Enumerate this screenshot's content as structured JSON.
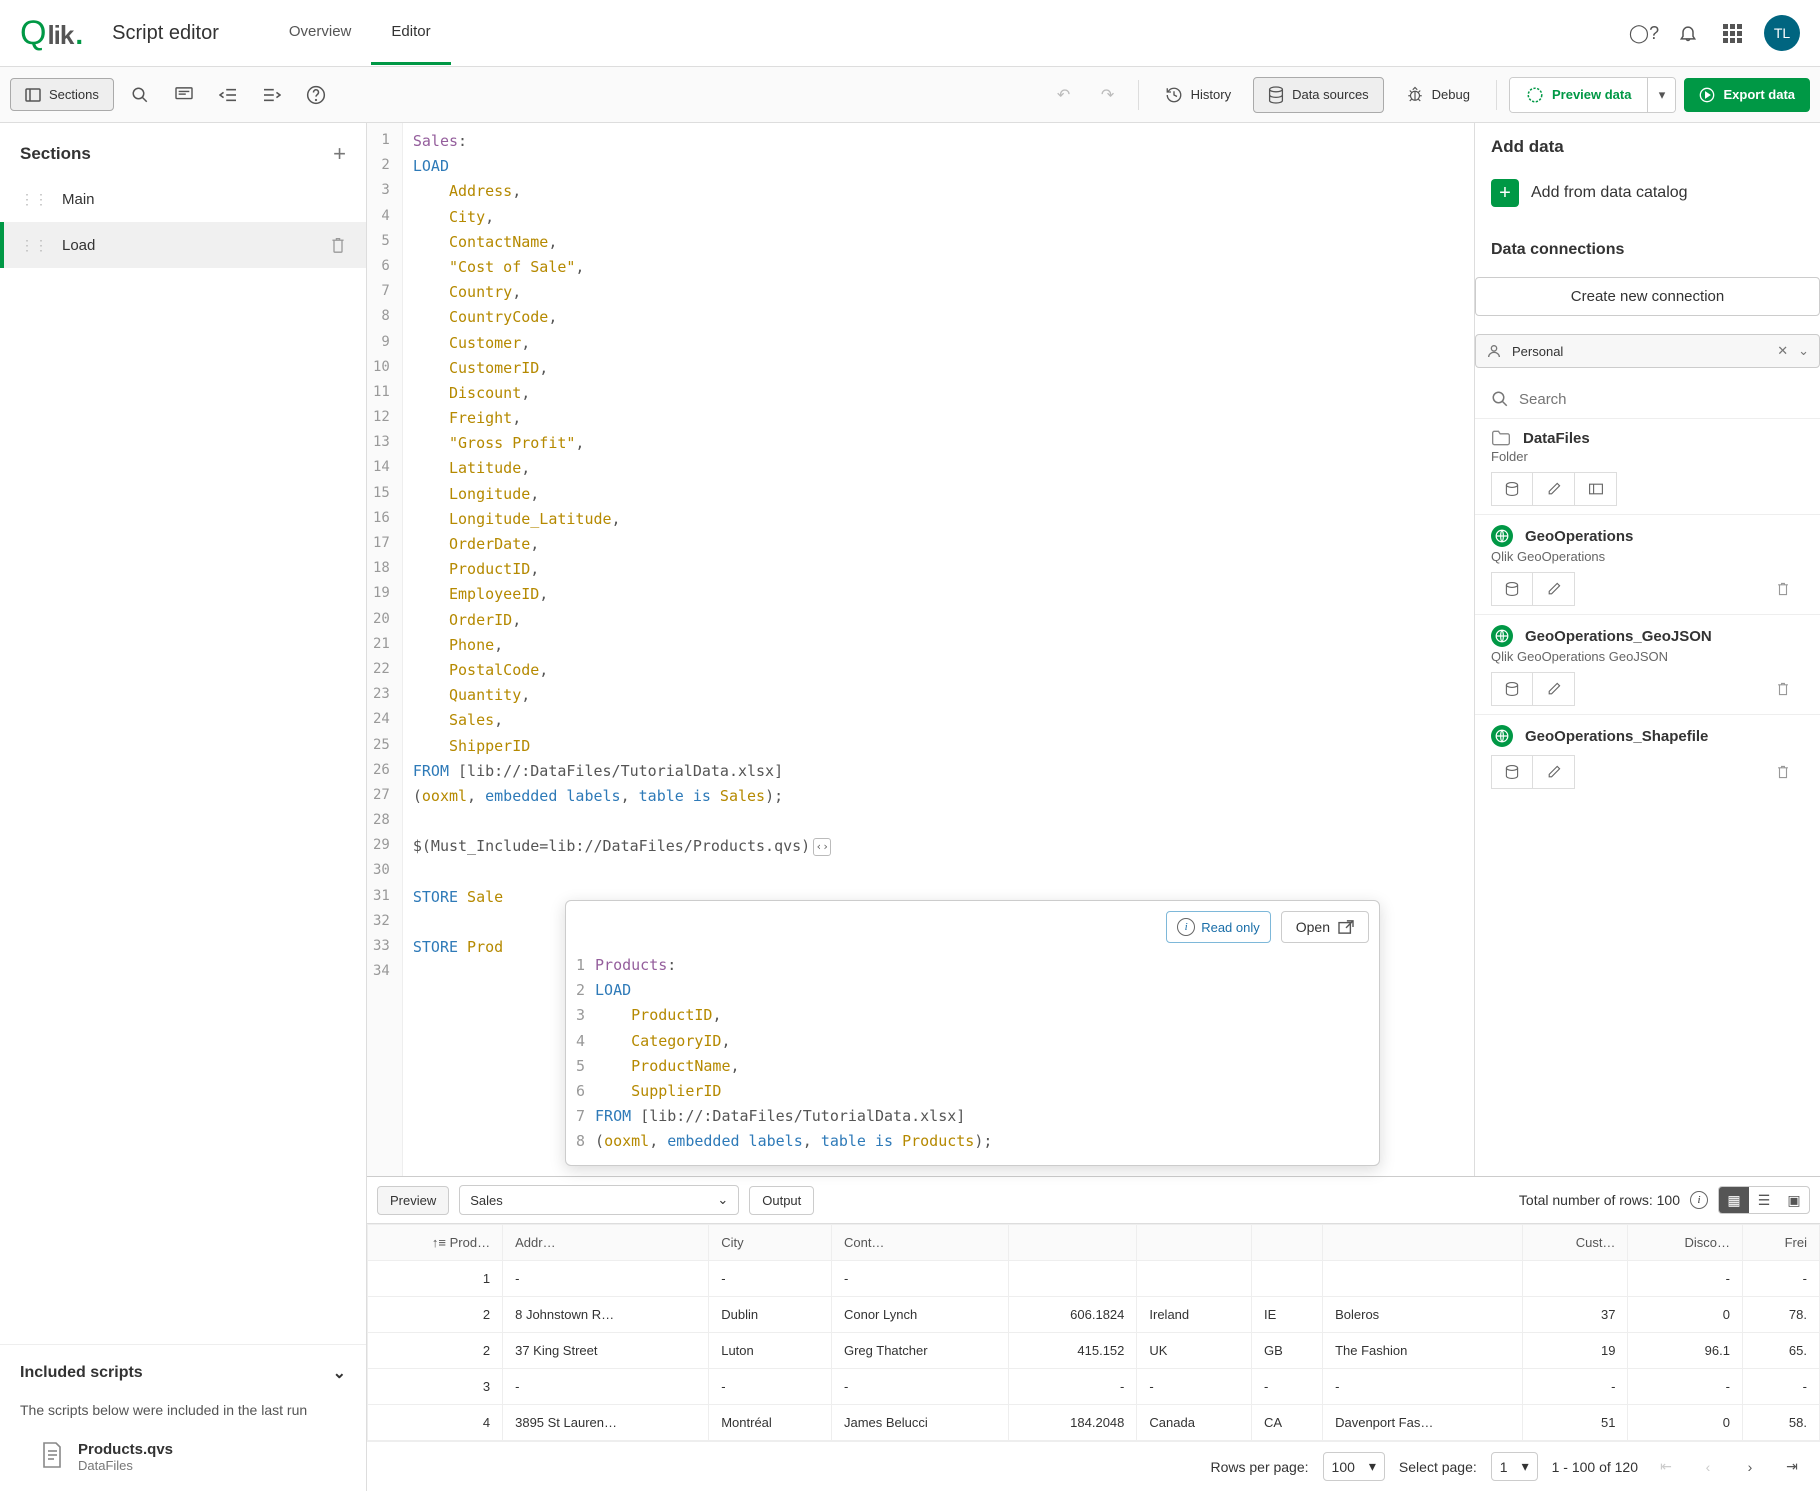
{
  "header": {
    "logo": "Qlik",
    "app_title": "Script editor",
    "tabs": {
      "overview": "Overview",
      "editor": "Editor"
    },
    "avatar": "TL"
  },
  "toolbar": {
    "sections": "Sections",
    "history": "History",
    "data_sources": "Data sources",
    "debug": "Debug",
    "preview_data": "Preview data",
    "export_data": "Export data"
  },
  "sidebar": {
    "title": "Sections",
    "items": [
      {
        "label": "Main",
        "selected": false
      },
      {
        "label": "Load",
        "selected": true
      }
    ],
    "included_title": "Included scripts",
    "included_note": "The scripts below were included in the last run",
    "included_file": {
      "name": "Products.qvs",
      "sub": "DataFiles"
    }
  },
  "editor": {
    "lines": [
      {
        "n": 1,
        "tokens": [
          [
            "label",
            "Sales"
          ],
          [
            "punc",
            ":"
          ]
        ]
      },
      {
        "n": 2,
        "tokens": [
          [
            "kw",
            "LOAD"
          ]
        ]
      },
      {
        "n": 3,
        "tokens": [
          [
            "pad",
            "    "
          ],
          [
            "field",
            "Address"
          ],
          [
            "punc",
            ","
          ]
        ]
      },
      {
        "n": 4,
        "tokens": [
          [
            "pad",
            "    "
          ],
          [
            "field",
            "City"
          ],
          [
            "punc",
            ","
          ]
        ]
      },
      {
        "n": 5,
        "tokens": [
          [
            "pad",
            "    "
          ],
          [
            "field",
            "ContactName"
          ],
          [
            "punc",
            ","
          ]
        ]
      },
      {
        "n": 6,
        "tokens": [
          [
            "pad",
            "    "
          ],
          [
            "str",
            "\"Cost of Sale\""
          ],
          [
            "punc",
            ","
          ]
        ]
      },
      {
        "n": 7,
        "tokens": [
          [
            "pad",
            "    "
          ],
          [
            "field",
            "Country"
          ],
          [
            "punc",
            ","
          ]
        ]
      },
      {
        "n": 8,
        "tokens": [
          [
            "pad",
            "    "
          ],
          [
            "field",
            "CountryCode"
          ],
          [
            "punc",
            ","
          ]
        ]
      },
      {
        "n": 9,
        "tokens": [
          [
            "pad",
            "    "
          ],
          [
            "field",
            "Customer"
          ],
          [
            "punc",
            ","
          ]
        ]
      },
      {
        "n": 10,
        "tokens": [
          [
            "pad",
            "    "
          ],
          [
            "field",
            "CustomerID"
          ],
          [
            "punc",
            ","
          ]
        ]
      },
      {
        "n": 11,
        "tokens": [
          [
            "pad",
            "    "
          ],
          [
            "field",
            "Discount"
          ],
          [
            "punc",
            ","
          ]
        ]
      },
      {
        "n": 12,
        "tokens": [
          [
            "pad",
            "    "
          ],
          [
            "field",
            "Freight"
          ],
          [
            "punc",
            ","
          ]
        ]
      },
      {
        "n": 13,
        "tokens": [
          [
            "pad",
            "    "
          ],
          [
            "str",
            "\"Gross Profit\""
          ],
          [
            "punc",
            ","
          ]
        ]
      },
      {
        "n": 14,
        "tokens": [
          [
            "pad",
            "    "
          ],
          [
            "field",
            "Latitude"
          ],
          [
            "punc",
            ","
          ]
        ]
      },
      {
        "n": 15,
        "tokens": [
          [
            "pad",
            "    "
          ],
          [
            "field",
            "Longitude"
          ],
          [
            "punc",
            ","
          ]
        ]
      },
      {
        "n": 16,
        "tokens": [
          [
            "pad",
            "    "
          ],
          [
            "field",
            "Longitude_Latitude"
          ],
          [
            "punc",
            ","
          ]
        ]
      },
      {
        "n": 17,
        "tokens": [
          [
            "pad",
            "    "
          ],
          [
            "field",
            "OrderDate"
          ],
          [
            "punc",
            ","
          ]
        ]
      },
      {
        "n": 18,
        "tokens": [
          [
            "pad",
            "    "
          ],
          [
            "field",
            "ProductID"
          ],
          [
            "punc",
            ","
          ]
        ]
      },
      {
        "n": 19,
        "tokens": [
          [
            "pad",
            "    "
          ],
          [
            "field",
            "EmployeeID"
          ],
          [
            "punc",
            ","
          ]
        ]
      },
      {
        "n": 20,
        "tokens": [
          [
            "pad",
            "    "
          ],
          [
            "field",
            "OrderID"
          ],
          [
            "punc",
            ","
          ]
        ]
      },
      {
        "n": 21,
        "tokens": [
          [
            "pad",
            "    "
          ],
          [
            "field",
            "Phone"
          ],
          [
            "punc",
            ","
          ]
        ]
      },
      {
        "n": 22,
        "tokens": [
          [
            "pad",
            "    "
          ],
          [
            "field",
            "PostalCode"
          ],
          [
            "punc",
            ","
          ]
        ]
      },
      {
        "n": 23,
        "tokens": [
          [
            "pad",
            "    "
          ],
          [
            "field",
            "Quantity"
          ],
          [
            "punc",
            ","
          ]
        ]
      },
      {
        "n": 24,
        "tokens": [
          [
            "pad",
            "    "
          ],
          [
            "field",
            "Sales"
          ],
          [
            "punc",
            ","
          ]
        ]
      },
      {
        "n": 25,
        "tokens": [
          [
            "pad",
            "    "
          ],
          [
            "field",
            "ShipperID"
          ]
        ]
      },
      {
        "n": 26,
        "tokens": [
          [
            "kw",
            "FROM "
          ],
          [
            "path",
            "[lib://:DataFiles/TutorialData.xlsx]"
          ]
        ]
      },
      {
        "n": 27,
        "tokens": [
          [
            "punc",
            "("
          ],
          [
            "field",
            "ooxml"
          ],
          [
            "punc",
            ", "
          ],
          [
            "kw",
            "embedded labels"
          ],
          [
            "punc",
            ", "
          ],
          [
            "kw",
            "table is "
          ],
          [
            "field",
            "Sales"
          ],
          [
            "punc",
            ");"
          ]
        ]
      },
      {
        "n": 28,
        "tokens": []
      },
      {
        "n": 29,
        "tokens": [
          [
            "path",
            "$(Must_Include=lib://DataFiles/Products.qvs)"
          ],
          [
            "chip",
            ""
          ]
        ]
      },
      {
        "n": 30,
        "tokens": []
      },
      {
        "n": 31,
        "tokens": [
          [
            "kw",
            "STORE "
          ],
          [
            "field",
            "Sale"
          ]
        ]
      },
      {
        "n": 32,
        "tokens": []
      },
      {
        "n": 33,
        "tokens": [
          [
            "kw",
            "STORE "
          ],
          [
            "field",
            "Prod"
          ]
        ]
      },
      {
        "n": 34,
        "tokens": []
      }
    ]
  },
  "popup": {
    "readonly": "Read only",
    "open": "Open",
    "lines": [
      {
        "n": 1,
        "tokens": [
          [
            "label",
            "Products"
          ],
          [
            "punc",
            ":"
          ]
        ]
      },
      {
        "n": 2,
        "tokens": [
          [
            "kw",
            "LOAD"
          ]
        ]
      },
      {
        "n": 3,
        "tokens": [
          [
            "pad",
            "    "
          ],
          [
            "field",
            "ProductID"
          ],
          [
            "punc",
            ","
          ]
        ]
      },
      {
        "n": 4,
        "tokens": [
          [
            "pad",
            "    "
          ],
          [
            "field",
            "CategoryID"
          ],
          [
            "punc",
            ","
          ]
        ]
      },
      {
        "n": 5,
        "tokens": [
          [
            "pad",
            "    "
          ],
          [
            "field",
            "ProductName"
          ],
          [
            "punc",
            ","
          ]
        ]
      },
      {
        "n": 6,
        "tokens": [
          [
            "pad",
            "    "
          ],
          [
            "field",
            "SupplierID"
          ]
        ]
      },
      {
        "n": 7,
        "tokens": [
          [
            "kw",
            "FROM "
          ],
          [
            "path",
            "[lib://:DataFiles/TutorialData.xlsx]"
          ]
        ]
      },
      {
        "n": 8,
        "tokens": [
          [
            "punc",
            "("
          ],
          [
            "field",
            "ooxml"
          ],
          [
            "punc",
            ", "
          ],
          [
            "kw",
            "embedded labels"
          ],
          [
            "punc",
            ", "
          ],
          [
            "kw",
            "table is "
          ],
          [
            "field",
            "Products"
          ],
          [
            "punc",
            ");"
          ]
        ]
      }
    ]
  },
  "rpanel": {
    "add_title": "Add data",
    "add_catalog": "Add from data catalog",
    "conn_title": "Data connections",
    "create": "Create new connection",
    "space": "Personal",
    "search_placeholder": "Search",
    "items": [
      {
        "icon": "folder",
        "name": "DataFiles",
        "sub": "Folder"
      },
      {
        "icon": "globe",
        "name": "GeoOperations",
        "sub": "Qlik GeoOperations"
      },
      {
        "icon": "globe",
        "name": "GeoOperations_GeoJSON",
        "sub": "Qlik GeoOperations GeoJSON"
      },
      {
        "icon": "globe",
        "name": "GeoOperations_Shapefile",
        "sub": ""
      }
    ]
  },
  "preview": {
    "bar": {
      "preview": "Preview",
      "table": "Sales",
      "output": "Output",
      "total": "Total number of rows: 100"
    },
    "headers": [
      "Prod…",
      "Addr…",
      "City",
      "Cont…",
      "",
      "",
      "",
      "",
      "Cust…",
      "Disco…",
      "Frei"
    ],
    "rows": [
      {
        "prod": "1",
        "addr": "-",
        "city": "-",
        "cont": "-",
        "c5": "",
        "c6": "",
        "c7": "",
        "c8": "",
        "cust": "",
        "disc": "-",
        "frei": "-"
      },
      {
        "prod": "2",
        "addr": "8 Johnstown R…",
        "city": "Dublin",
        "cont": "Conor Lynch",
        "c5": "606.1824",
        "c6": "Ireland",
        "c7": "IE",
        "c8": "Boleros",
        "cust": "37",
        "disc": "0",
        "frei": "78."
      },
      {
        "prod": "2",
        "addr": "37 King Street",
        "city": "Luton",
        "cont": "Greg Thatcher",
        "c5": "415.152",
        "c6": "UK",
        "c7": "GB",
        "c8": "The Fashion",
        "cust": "19",
        "disc": "96.1",
        "frei": "65."
      },
      {
        "prod": "3",
        "addr": "-",
        "city": "-",
        "cont": "-",
        "c5": "-",
        "c6": "-",
        "c7": "-",
        "c8": "-",
        "cust": "-",
        "disc": "-",
        "frei": "-"
      },
      {
        "prod": "4",
        "addr": "3895 St Lauren…",
        "city": "Montréal",
        "cont": "James Belucci",
        "c5": "184.2048",
        "c6": "Canada",
        "c7": "CA",
        "c8": "Davenport Fas…",
        "cust": "51",
        "disc": "0",
        "frei": "58."
      }
    ],
    "pager": {
      "rows_label": "Rows per page:",
      "rows_value": "100",
      "select_page": "Select page:",
      "page_value": "1",
      "range": "1 - 100 of 120"
    }
  }
}
